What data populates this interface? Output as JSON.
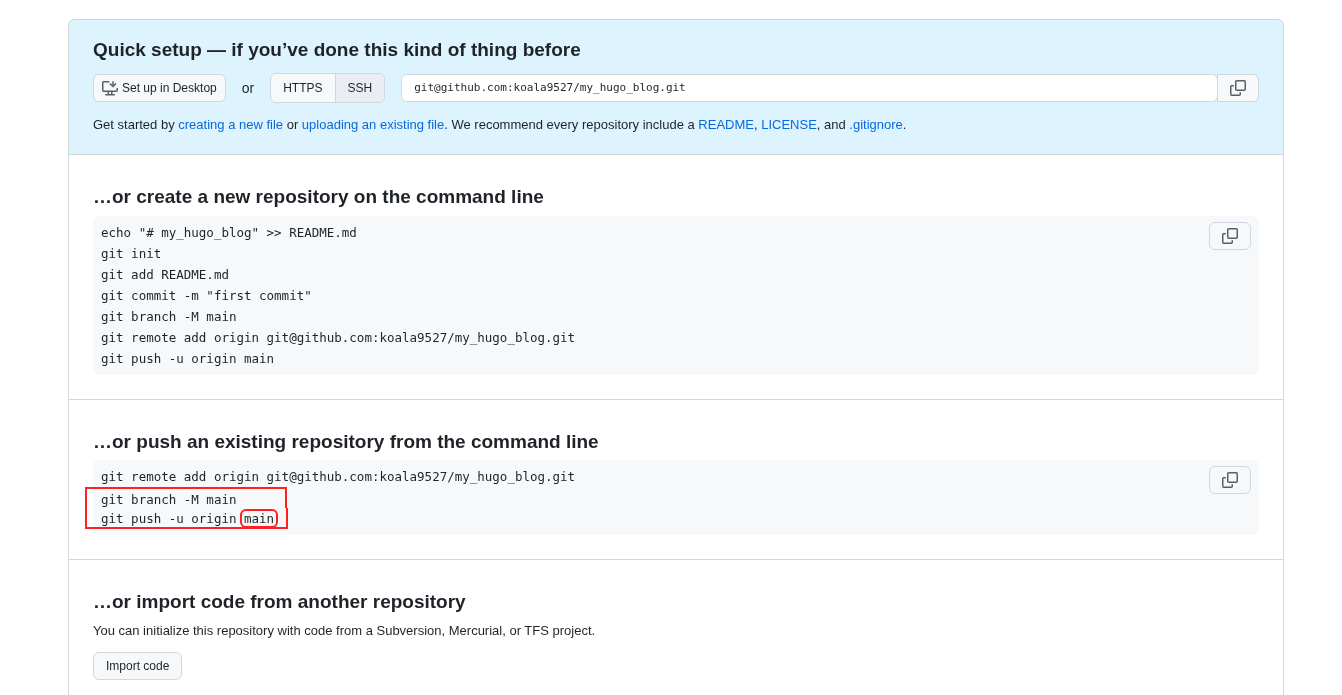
{
  "quick_setup": {
    "title": "Quick setup — if you’ve done this kind of thing before",
    "desktop_button": "Set up in Desktop",
    "or": "or",
    "protocols": [
      {
        "label": "HTTPS",
        "selected": false
      },
      {
        "label": "SSH",
        "selected": true
      }
    ],
    "url": "git@github.com:koala9527/my_hugo_blog.git",
    "hint": [
      {
        "text": "Get started by ",
        "link": false
      },
      {
        "text": "creating a new file",
        "link": true
      },
      {
        "text": " or ",
        "link": false
      },
      {
        "text": "uploading an existing file",
        "link": true
      },
      {
        "text": ". We recommend every repository include a ",
        "link": false
      },
      {
        "text": "README",
        "link": true
      },
      {
        "text": ", ",
        "link": false
      },
      {
        "text": "LICENSE",
        "link": true
      },
      {
        "text": ", and ",
        "link": false
      },
      {
        "text": ".gitignore",
        "link": true
      },
      {
        "text": ".",
        "link": false
      }
    ]
  },
  "command_sections": [
    {
      "title": "…or create a new repository on the command line",
      "lines": [
        {
          "marked": false,
          "parts": [
            {
              "text": "echo \"# my_hugo_blog\" >> README.md",
              "marked": false
            }
          ]
        },
        {
          "marked": false,
          "parts": [
            {
              "text": "git init",
              "marked": false
            }
          ]
        },
        {
          "marked": false,
          "parts": [
            {
              "text": "git add README.md",
              "marked": false
            }
          ]
        },
        {
          "marked": false,
          "parts": [
            {
              "text": "git commit -m \"first commit\"",
              "marked": false
            }
          ]
        },
        {
          "marked": false,
          "parts": [
            {
              "text": "git branch -M main",
              "marked": false
            }
          ]
        },
        {
          "marked": false,
          "parts": [
            {
              "text": "git remote add origin git@github.com:koala9527/my_hugo_blog.git",
              "marked": false
            }
          ]
        },
        {
          "marked": false,
          "parts": [
            {
              "text": "git push -u origin main",
              "marked": false
            }
          ]
        }
      ]
    },
    {
      "title": "…or push an existing repository from the command line",
      "lines": [
        {
          "marked": false,
          "parts": [
            {
              "text": "git remote add origin git@github.com:koala9527/my_hugo_blog.git",
              "marked": false
            }
          ]
        },
        {
          "marked": true,
          "parts": [
            {
              "text": "git branch -M main",
              "marked": false
            }
          ]
        },
        {
          "marked": true,
          "parts": [
            {
              "text": "git push -u origin ",
              "marked": false
            },
            {
              "text": "main",
              "marked": true
            }
          ]
        }
      ]
    }
  ],
  "import": {
    "title": "…or import code from another repository",
    "description": "You can initialize this repository with code from a Subversion, Mercurial, or TFS project.",
    "button": "Import code"
  }
}
